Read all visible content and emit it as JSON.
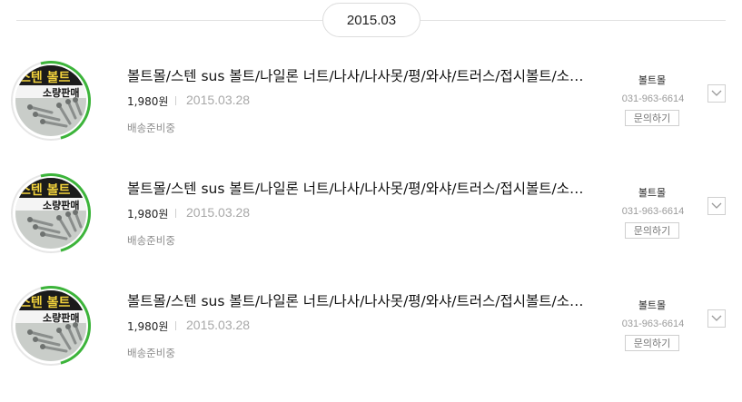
{
  "date_group": "2015.03",
  "orders": [
    {
      "title": "볼트몰/스텐 sus 볼트/나일론 너트/나사/나사못/평/와샤/트러스/접시볼트/소량판매",
      "price": "1,980원",
      "date": "2015.03.28",
      "status": "배송준비중",
      "seller": "볼트몰",
      "phone": "031-963-6614",
      "inquiry_label": "문의하기",
      "thumb_text_top": "스텐 볼트",
      "thumb_text_bottom": "소량판매"
    },
    {
      "title": "볼트몰/스텐 sus 볼트/나일론 너트/나사/나사못/평/와샤/트러스/접시볼트/소량판매",
      "price": "1,980원",
      "date": "2015.03.28",
      "status": "배송준비중",
      "seller": "볼트몰",
      "phone": "031-963-6614",
      "inquiry_label": "문의하기",
      "thumb_text_top": "스텐 볼트",
      "thumb_text_bottom": "소량판매"
    },
    {
      "title": "볼트몰/스텐 sus 볼트/나일론 너트/나사/나사못/평/와샤/트러스/접시볼트/소량판매",
      "price": "1,980원",
      "date": "2015.03.28",
      "status": "배송준비중",
      "seller": "볼트몰",
      "phone": "031-963-6614",
      "inquiry_label": "문의하기",
      "thumb_text_top": "스텐 볼트",
      "thumb_text_bottom": "소량판매"
    }
  ],
  "icons": {
    "toggle": "chevron-down-icon"
  },
  "colors": {
    "ring_accent": "#3cb43a",
    "date_gray": "#a8a8a8"
  }
}
